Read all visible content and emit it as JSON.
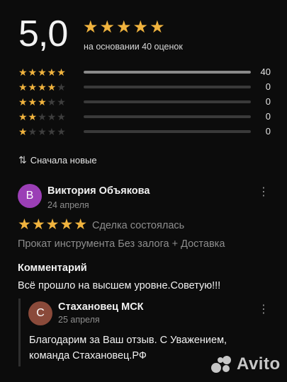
{
  "rating": {
    "score": "5,0",
    "based_on": "на основании 40 оценок"
  },
  "breakdown": [
    {
      "stars": 5,
      "count": "40",
      "fraction": 1.0
    },
    {
      "stars": 4,
      "count": "0",
      "fraction": 0.0
    },
    {
      "stars": 3,
      "count": "0",
      "fraction": 0.0
    },
    {
      "stars": 2,
      "count": "0",
      "fraction": 0.0
    },
    {
      "stars": 1,
      "count": "0",
      "fraction": 0.0
    }
  ],
  "sort": {
    "label": "Сначала новые",
    "icon": "sort-arrows-icon"
  },
  "review": {
    "avatar_letter": "В",
    "author": "Виктория Объякова",
    "date": "24 апреля",
    "stars": 5,
    "deal_status": "Сделка состоялась",
    "service": "Прокат инструмента Без залога + Доставка",
    "comment_heading": "Комментарий",
    "comment": "Всё прошло на высшем уровне.Советую!!!",
    "avatar_color": "#9b3fb6"
  },
  "reply": {
    "avatar_letter": "С",
    "author": "Стахановец МСК",
    "date": "25 апреля",
    "text": "Благодарим за Ваш отзыв. С Уважением, команда Стахановец.РФ",
    "avatar_color": "#8a4a3a"
  },
  "watermark": {
    "text": "Avito"
  },
  "colors": {
    "star_on": "#f0b33e",
    "star_off": "#3d3d3d",
    "background": "#0c0c0c"
  }
}
